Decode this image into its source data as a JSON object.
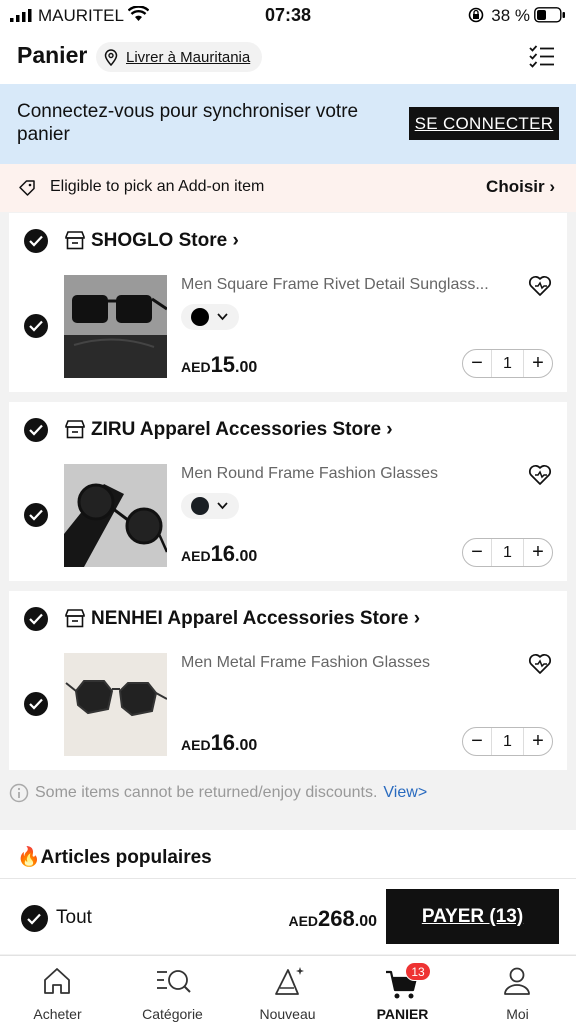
{
  "status_bar": {
    "carrier": "MAURITEL",
    "time": "07:38",
    "battery": "38 %"
  },
  "header": {
    "title": "Panier",
    "location": "Livrer à Mauritania"
  },
  "login_banner": {
    "text": "Connectez-vous pour synchroniser votre panier",
    "button": "SE CONNECTER"
  },
  "addon": {
    "text": "Eligible to pick an Add-on item",
    "action": "Choisir"
  },
  "stores": [
    {
      "name": "SHOGLO Store",
      "product": "Men Square Frame Rivet Detail Sunglass...",
      "currency": "AED",
      "price_int": "15",
      "price_dec": ".00",
      "qty": "1",
      "variant_color": "#000000"
    },
    {
      "name": "ZIRU Apparel Accessories Store",
      "product": "Men Round Frame Fashion Glasses",
      "currency": "AED",
      "price_int": "16",
      "price_dec": ".00",
      "qty": "1",
      "variant_color": "#1a1f24"
    },
    {
      "name": "NENHEI Apparel Accessories Store",
      "product": "Men Metal Frame Fashion Glasses",
      "currency": "AED",
      "price_int": "16",
      "price_dec": ".00",
      "qty": "1"
    }
  ],
  "notice": {
    "text": "Some items cannot be returned/enjoy discounts.",
    "link": "View>"
  },
  "popular": {
    "title": "Articles populaires"
  },
  "checkout": {
    "all_label": "Tout",
    "currency": "AED",
    "total_int": "268",
    "total_dec": ".00",
    "pay_button": "PAYER (13)"
  },
  "tabbar": {
    "items": [
      {
        "label": "Acheter",
        "icon": "home-icon"
      },
      {
        "label": "Catégorie",
        "icon": "category-search-icon"
      },
      {
        "label": "Nouveau",
        "icon": "new-sparkle-icon"
      },
      {
        "label": "PANIER",
        "icon": "cart-icon",
        "active": true,
        "badge": "13"
      },
      {
        "label": "Moi",
        "icon": "profile-icon"
      }
    ]
  },
  "colors": {
    "banner_bg": "#d8e9f9",
    "addon_bg": "#fdf2ee",
    "primary": "#111111",
    "badge": "#e33333",
    "link": "#2a6bbf"
  }
}
